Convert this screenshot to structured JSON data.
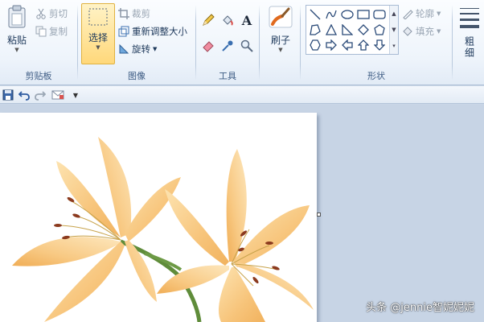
{
  "ribbon": {
    "clipboard": {
      "paste_label": "粘贴",
      "cut_label": "剪切",
      "copy_label": "复制",
      "group_label": "剪贴板"
    },
    "image": {
      "select_label": "选择",
      "crop_label": "裁剪",
      "resize_label": "重新调整大小",
      "rotate_label": "旋转",
      "group_label": "图像"
    },
    "tools": {
      "group_label": "工具",
      "icons": [
        "pencil-icon",
        "fill-icon",
        "text-icon",
        "eraser-icon",
        "color-picker-icon",
        "magnifier-icon"
      ]
    },
    "brushes": {
      "label": "刷子"
    },
    "shapes": {
      "group_label": "形状",
      "outline_label": "轮廓",
      "fill_label": "填充",
      "icons": [
        "line",
        "curve",
        "oval",
        "rectangle",
        "rounded-rectangle",
        "polygon",
        "triangle",
        "right-triangle",
        "diamond",
        "pentagon",
        "hexagon",
        "right-arrow",
        "left-arrow",
        "up-arrow",
        "down-arrow"
      ]
    },
    "size": {
      "label": "粗细"
    }
  },
  "quick_access": {
    "icons": [
      "save-icon",
      "undo-icon",
      "redo-icon",
      "email-icon",
      "customize-dropdown-icon"
    ]
  },
  "watermark": "头条 @jennie智妮妮妮",
  "colors": {
    "ribbon_bg": "#eef4fb",
    "accent_select": "#ffd87a",
    "workspace_bg": "#c7d4e5",
    "lily_petal": "#f7c47a"
  }
}
